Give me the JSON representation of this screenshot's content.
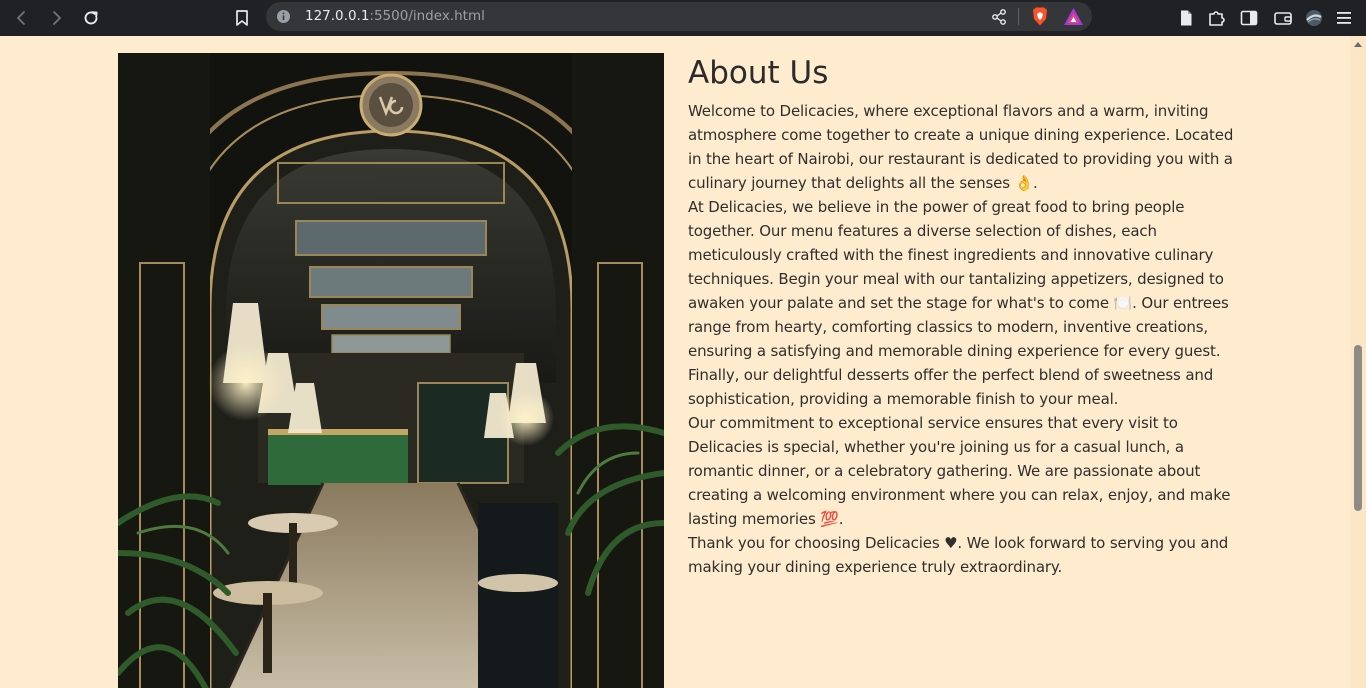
{
  "browser": {
    "url_host": "127.0.0.1",
    "url_rest": ":5500/index.html",
    "accent_brave": "#fb542b",
    "accent_rewards": "#a23bd8"
  },
  "about": {
    "title": "About Us",
    "image_alt": "Restaurant interior",
    "paragraphs": [
      "Welcome to Delicacies, where exceptional flavors and a warm, inviting atmosphere come together to create a unique dining experience. Located in the heart of Nairobi, our restaurant is dedicated to providing you with a culinary journey that delights all the senses 👌.",
      "At Delicacies, we believe in the power of great food to bring people together. Our menu features a diverse selection of dishes, each meticulously crafted with the finest ingredients and innovative culinary techniques. Begin your meal with our tantalizing appetizers, designed to awaken your palate and set the stage for what's to come 🍽️. Our entrees range from hearty, comforting classics to modern, inventive creations, ensuring a satisfying and memorable dining experience for every guest. Finally, our delightful desserts offer the perfect blend of sweetness and sophistication, providing a memorable finish to your meal.",
      "Our commitment to exceptional service ensures that every visit to Delicacies is special, whether you're joining us for a casual lunch, a romantic dinner, or a celebratory gathering. We are passionate about creating a welcoming environment where you can relax, enjoy, and make lasting memories 💯.",
      "Thank you for choosing Delicacies ♥. We look forward to serving you and making your dining experience truly extraordinary."
    ]
  },
  "colors": {
    "page_background": "#ffebcd",
    "text": "#2f2f2f"
  }
}
